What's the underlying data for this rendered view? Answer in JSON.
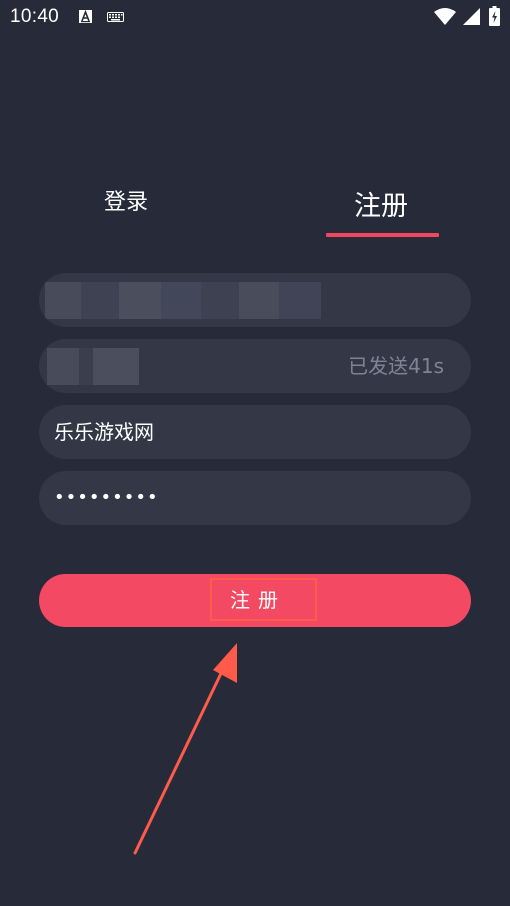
{
  "status_bar": {
    "time": "10:40",
    "icons": [
      "a-icon",
      "keyboard-icon",
      "wifi-icon",
      "signal-icon",
      "battery-charging-icon"
    ]
  },
  "tabs": [
    {
      "label": "登录",
      "selected": false
    },
    {
      "label": "注册",
      "selected": true
    }
  ],
  "form": {
    "account_field": {
      "value": "",
      "obscured": true
    },
    "verification_code_field": {
      "value": "",
      "obscured": true,
      "countdown_label": "已发送41s"
    },
    "nickname_field": {
      "value": "乐乐游戏网"
    },
    "password_field": {
      "value": "•••••••••"
    }
  },
  "submit_button": {
    "label": "注册"
  },
  "colors": {
    "background": "#262a39",
    "field_background": "#333746",
    "accent": "#f44963",
    "tab_indicator": "#f0465f",
    "muted_text": "#7f8393",
    "annotation": "#ff5a4a"
  }
}
